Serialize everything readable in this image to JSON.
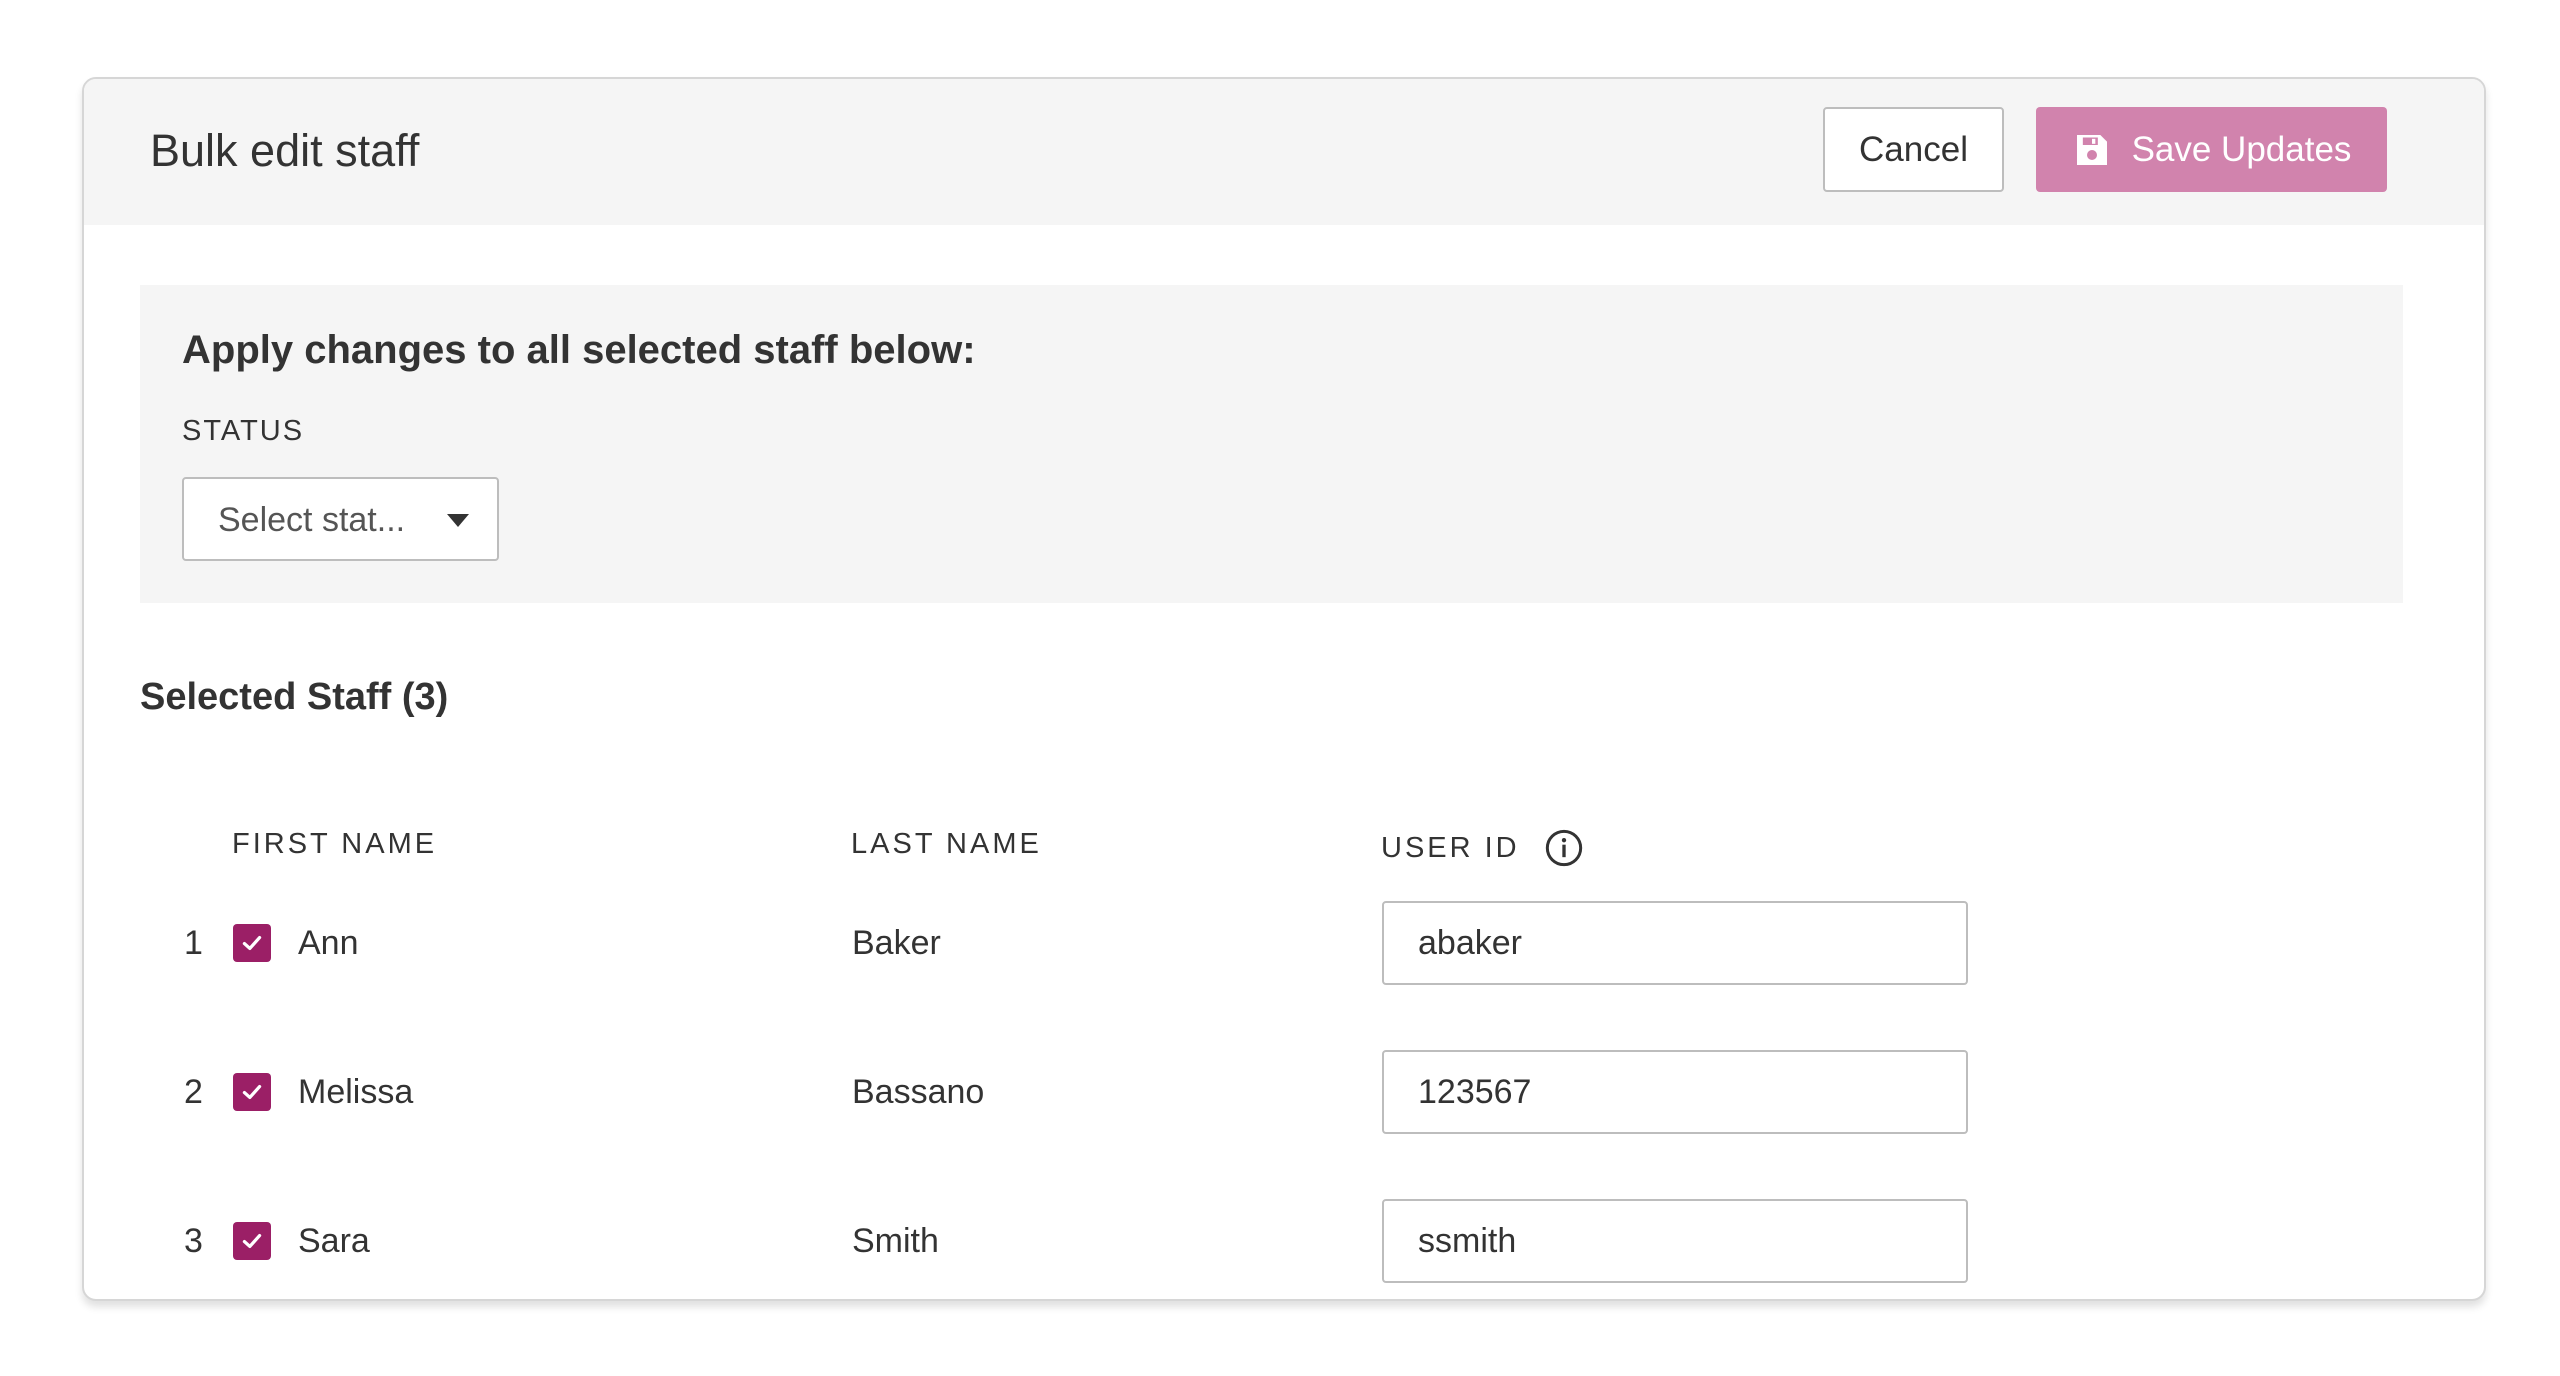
{
  "header": {
    "title": "Bulk edit staff",
    "cancel_label": "Cancel",
    "save_label": "Save Updates"
  },
  "apply_panel": {
    "title": "Apply changes to all selected staff below:",
    "status_label": "STATUS",
    "status_placeholder": "Select stat..."
  },
  "selected": {
    "title": "Selected Staff (3)",
    "columns": {
      "first_name": "FIRST NAME",
      "last_name": "LAST NAME",
      "user_id": "USER ID"
    },
    "rows": [
      {
        "num": "1",
        "checked": true,
        "first": "Ann",
        "last": "Baker",
        "user_id": "abaker"
      },
      {
        "num": "2",
        "checked": true,
        "first": "Melissa",
        "last": "Bassano",
        "user_id": "123567"
      },
      {
        "num": "3",
        "checked": true,
        "first": "Sara",
        "last": "Smith",
        "user_id": "ssmith"
      }
    ]
  },
  "icons": {
    "save": "floppy-disk-icon",
    "info": "info-icon",
    "dropdown": "caret-down-icon",
    "check": "checkmark-icon"
  },
  "colors": {
    "primary_button": "#d183ad",
    "checkbox": "#9b1f66",
    "panel_bg": "#f5f5f5"
  }
}
